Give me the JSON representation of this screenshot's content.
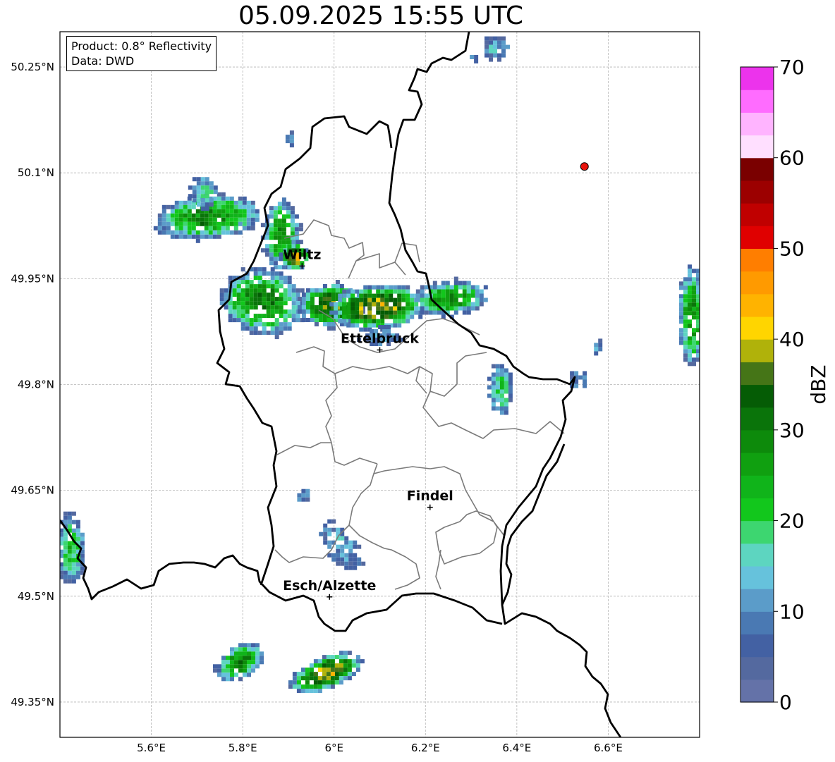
{
  "title": "05.09.2025 15:55 UTC",
  "info": {
    "product": "Product: 0.8° Reflectivity",
    "data": "Data: DWD"
  },
  "axes": {
    "lon_min": 5.4,
    "lon_max": 6.8,
    "lat_min": 49.3,
    "lat_max": 50.3,
    "x_ticks": [
      {
        "value": 5.6,
        "label": "5.6°E"
      },
      {
        "value": 5.8,
        "label": "5.8°E"
      },
      {
        "value": 6.0,
        "label": "6°E"
      },
      {
        "value": 6.2,
        "label": "6.2°E"
      },
      {
        "value": 6.4,
        "label": "6.4°E"
      },
      {
        "value": 6.6,
        "label": "6.6°E"
      }
    ],
    "y_ticks": [
      {
        "value": 50.25,
        "label": "50.25°N"
      },
      {
        "value": 50.1,
        "label": "50.1°N"
      },
      {
        "value": 49.95,
        "label": "49.95°N"
      },
      {
        "value": 49.8,
        "label": "49.8°N"
      },
      {
        "value": 49.65,
        "label": "49.65°N"
      },
      {
        "value": 49.5,
        "label": "49.5°N"
      },
      {
        "value": 49.35,
        "label": "49.35°N"
      }
    ],
    "grid": true
  },
  "cities": [
    {
      "name": "Wiltz",
      "lon": 5.93,
      "lat": 49.968
    },
    {
      "name": "Ettelbruck",
      "lon": 6.1,
      "lat": 49.849
    },
    {
      "name": "Findel",
      "lon": 6.21,
      "lat": 49.626
    },
    {
      "name": "Esch/Alzette",
      "lon": 5.99,
      "lat": 49.499
    }
  ],
  "radar_site": {
    "lon": 6.548,
    "lat": 50.109,
    "color": "#e8140c"
  },
  "colorbar": {
    "label": "dBZ",
    "min": 0,
    "max": 70,
    "step": 2.5,
    "ticks": [
      0,
      10,
      20,
      30,
      40,
      50,
      60,
      70
    ],
    "colors": [
      "#6472a8",
      "#54699f",
      "#4361a3",
      "#4a79b3",
      "#5b9cc9",
      "#66c2dc",
      "#5dd5c0",
      "#3dd670",
      "#12c71c",
      "#10b41a",
      "#10a010",
      "#0d8a0b",
      "#0a740a",
      "#055c05",
      "#457517",
      "#b0b20a",
      "#ffd500",
      "#ffb300",
      "#ff9a00",
      "#ff7e00",
      "#e00000",
      "#c00000",
      "#9c0000",
      "#7a0000",
      "#ffdfff",
      "#ffb4ff",
      "#ff6cff",
      "#ec33ec"
    ]
  },
  "echoes": [
    {
      "lon": 5.72,
      "lat": 50.04,
      "rx": 0.115,
      "ry": 0.03,
      "peak": 32,
      "angle": -5
    },
    {
      "lon": 5.71,
      "lat": 50.075,
      "rx": 0.03,
      "ry": 0.025,
      "peak": 20,
      "angle": 0
    },
    {
      "lon": 5.88,
      "lat": 50.015,
      "rx": 0.04,
      "ry": 0.05,
      "peak": 30,
      "angle": 0
    },
    {
      "lon": 5.91,
      "lat": 49.985,
      "rx": 0.03,
      "ry": 0.02,
      "peak": 45,
      "angle": 0
    },
    {
      "lon": 5.84,
      "lat": 49.92,
      "rx": 0.09,
      "ry": 0.045,
      "peak": 33,
      "angle": 10
    },
    {
      "lon": 5.99,
      "lat": 49.915,
      "rx": 0.07,
      "ry": 0.03,
      "peak": 38,
      "angle": 0
    },
    {
      "lon": 6.09,
      "lat": 49.912,
      "rx": 0.1,
      "ry": 0.03,
      "peak": 43,
      "angle": -4
    },
    {
      "lon": 6.1,
      "lat": 49.87,
      "rx": 0.05,
      "ry": 0.015,
      "peak": 14,
      "angle": 0
    },
    {
      "lon": 6.25,
      "lat": 49.925,
      "rx": 0.08,
      "ry": 0.025,
      "peak": 30,
      "angle": -5
    },
    {
      "lon": 6.36,
      "lat": 49.795,
      "rx": 0.025,
      "ry": 0.04,
      "peak": 22,
      "angle": 0
    },
    {
      "lon": 6.53,
      "lat": 49.81,
      "rx": 0.02,
      "ry": 0.015,
      "peak": 14,
      "angle": 0
    },
    {
      "lon": 6.575,
      "lat": 49.855,
      "rx": 0.012,
      "ry": 0.01,
      "peak": 16,
      "angle": 0
    },
    {
      "lon": 6.78,
      "lat": 49.9,
      "rx": 0.03,
      "ry": 0.07,
      "peak": 30,
      "angle": 0
    },
    {
      "lon": 5.42,
      "lat": 49.57,
      "rx": 0.03,
      "ry": 0.05,
      "peak": 24,
      "angle": 0
    },
    {
      "lon": 5.79,
      "lat": 49.41,
      "rx": 0.055,
      "ry": 0.022,
      "peak": 32,
      "angle": -30
    },
    {
      "lon": 5.98,
      "lat": 49.395,
      "rx": 0.08,
      "ry": 0.022,
      "peak": 42,
      "angle": -22
    },
    {
      "lon": 6.01,
      "lat": 49.575,
      "rx": 0.035,
      "ry": 0.04,
      "peak": 16,
      "angle": -40
    },
    {
      "lon": 5.93,
      "lat": 49.645,
      "rx": 0.02,
      "ry": 0.007,
      "peak": 14,
      "angle": -40
    },
    {
      "lon": 6.35,
      "lat": 50.28,
      "rx": 0.03,
      "ry": 0.018,
      "peak": 16,
      "angle": 0
    },
    {
      "lon": 6.3,
      "lat": 50.265,
      "rx": 0.01,
      "ry": 0.008,
      "peak": 12,
      "angle": 0
    },
    {
      "lon": 5.9,
      "lat": 50.15,
      "rx": 0.01,
      "ry": 0.01,
      "peak": 10,
      "angle": 0
    }
  ]
}
